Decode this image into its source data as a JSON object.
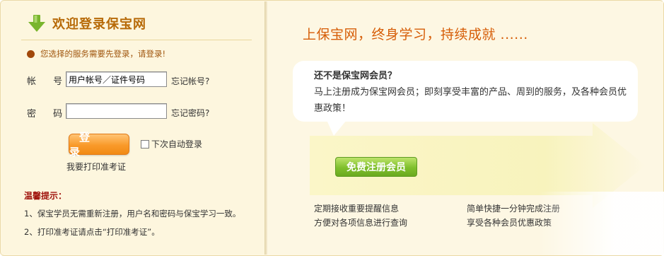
{
  "login": {
    "title": "欢迎登录保宝网",
    "notice": "您选择的服务需要先登录，请登录!",
    "account_label": "帐 号:",
    "account_value": "用户帐号／证件号码",
    "forgot_account": "忘记帐号?",
    "password_label": "密 码:",
    "password_value": "",
    "forgot_password": "忘记密码?",
    "login_button": "登 录",
    "auto_login_label": "下次自动登录",
    "print_link": "我要打印准考证",
    "tips_title": "温馨提示：",
    "tips": [
      "1、保宝学员无需重新注册，用户名和密码与保宝学习一致。",
      "2、打印准考证请点击“打印准考证”。"
    ]
  },
  "promo": {
    "slogan": "上保宝网，终身学习，持续成就 ......",
    "bubble_title": "还不是保宝网会员？",
    "bubble_text": "马上注册成为保宝网会员；即刻享受丰富的产品、周到的服务，及各种会员优惠政策！",
    "register_button": "免费注册会员",
    "benefits_left": [
      "定期接收重要提醒信息",
      "方便对各项信息进行查询"
    ],
    "benefits_right": [
      "简单快捷一分钟完成注册",
      "享受各种会员优惠政策"
    ]
  },
  "colors": {
    "title": "#b76a08",
    "slogan": "#d65d07",
    "login_button": "#f99a2a",
    "register_button": "#7fbf2c",
    "tips_title": "#a0150e"
  },
  "icons": {
    "title_icon": "green-down-arrow-icon",
    "notice_icon": "bullet-dot-icon"
  }
}
